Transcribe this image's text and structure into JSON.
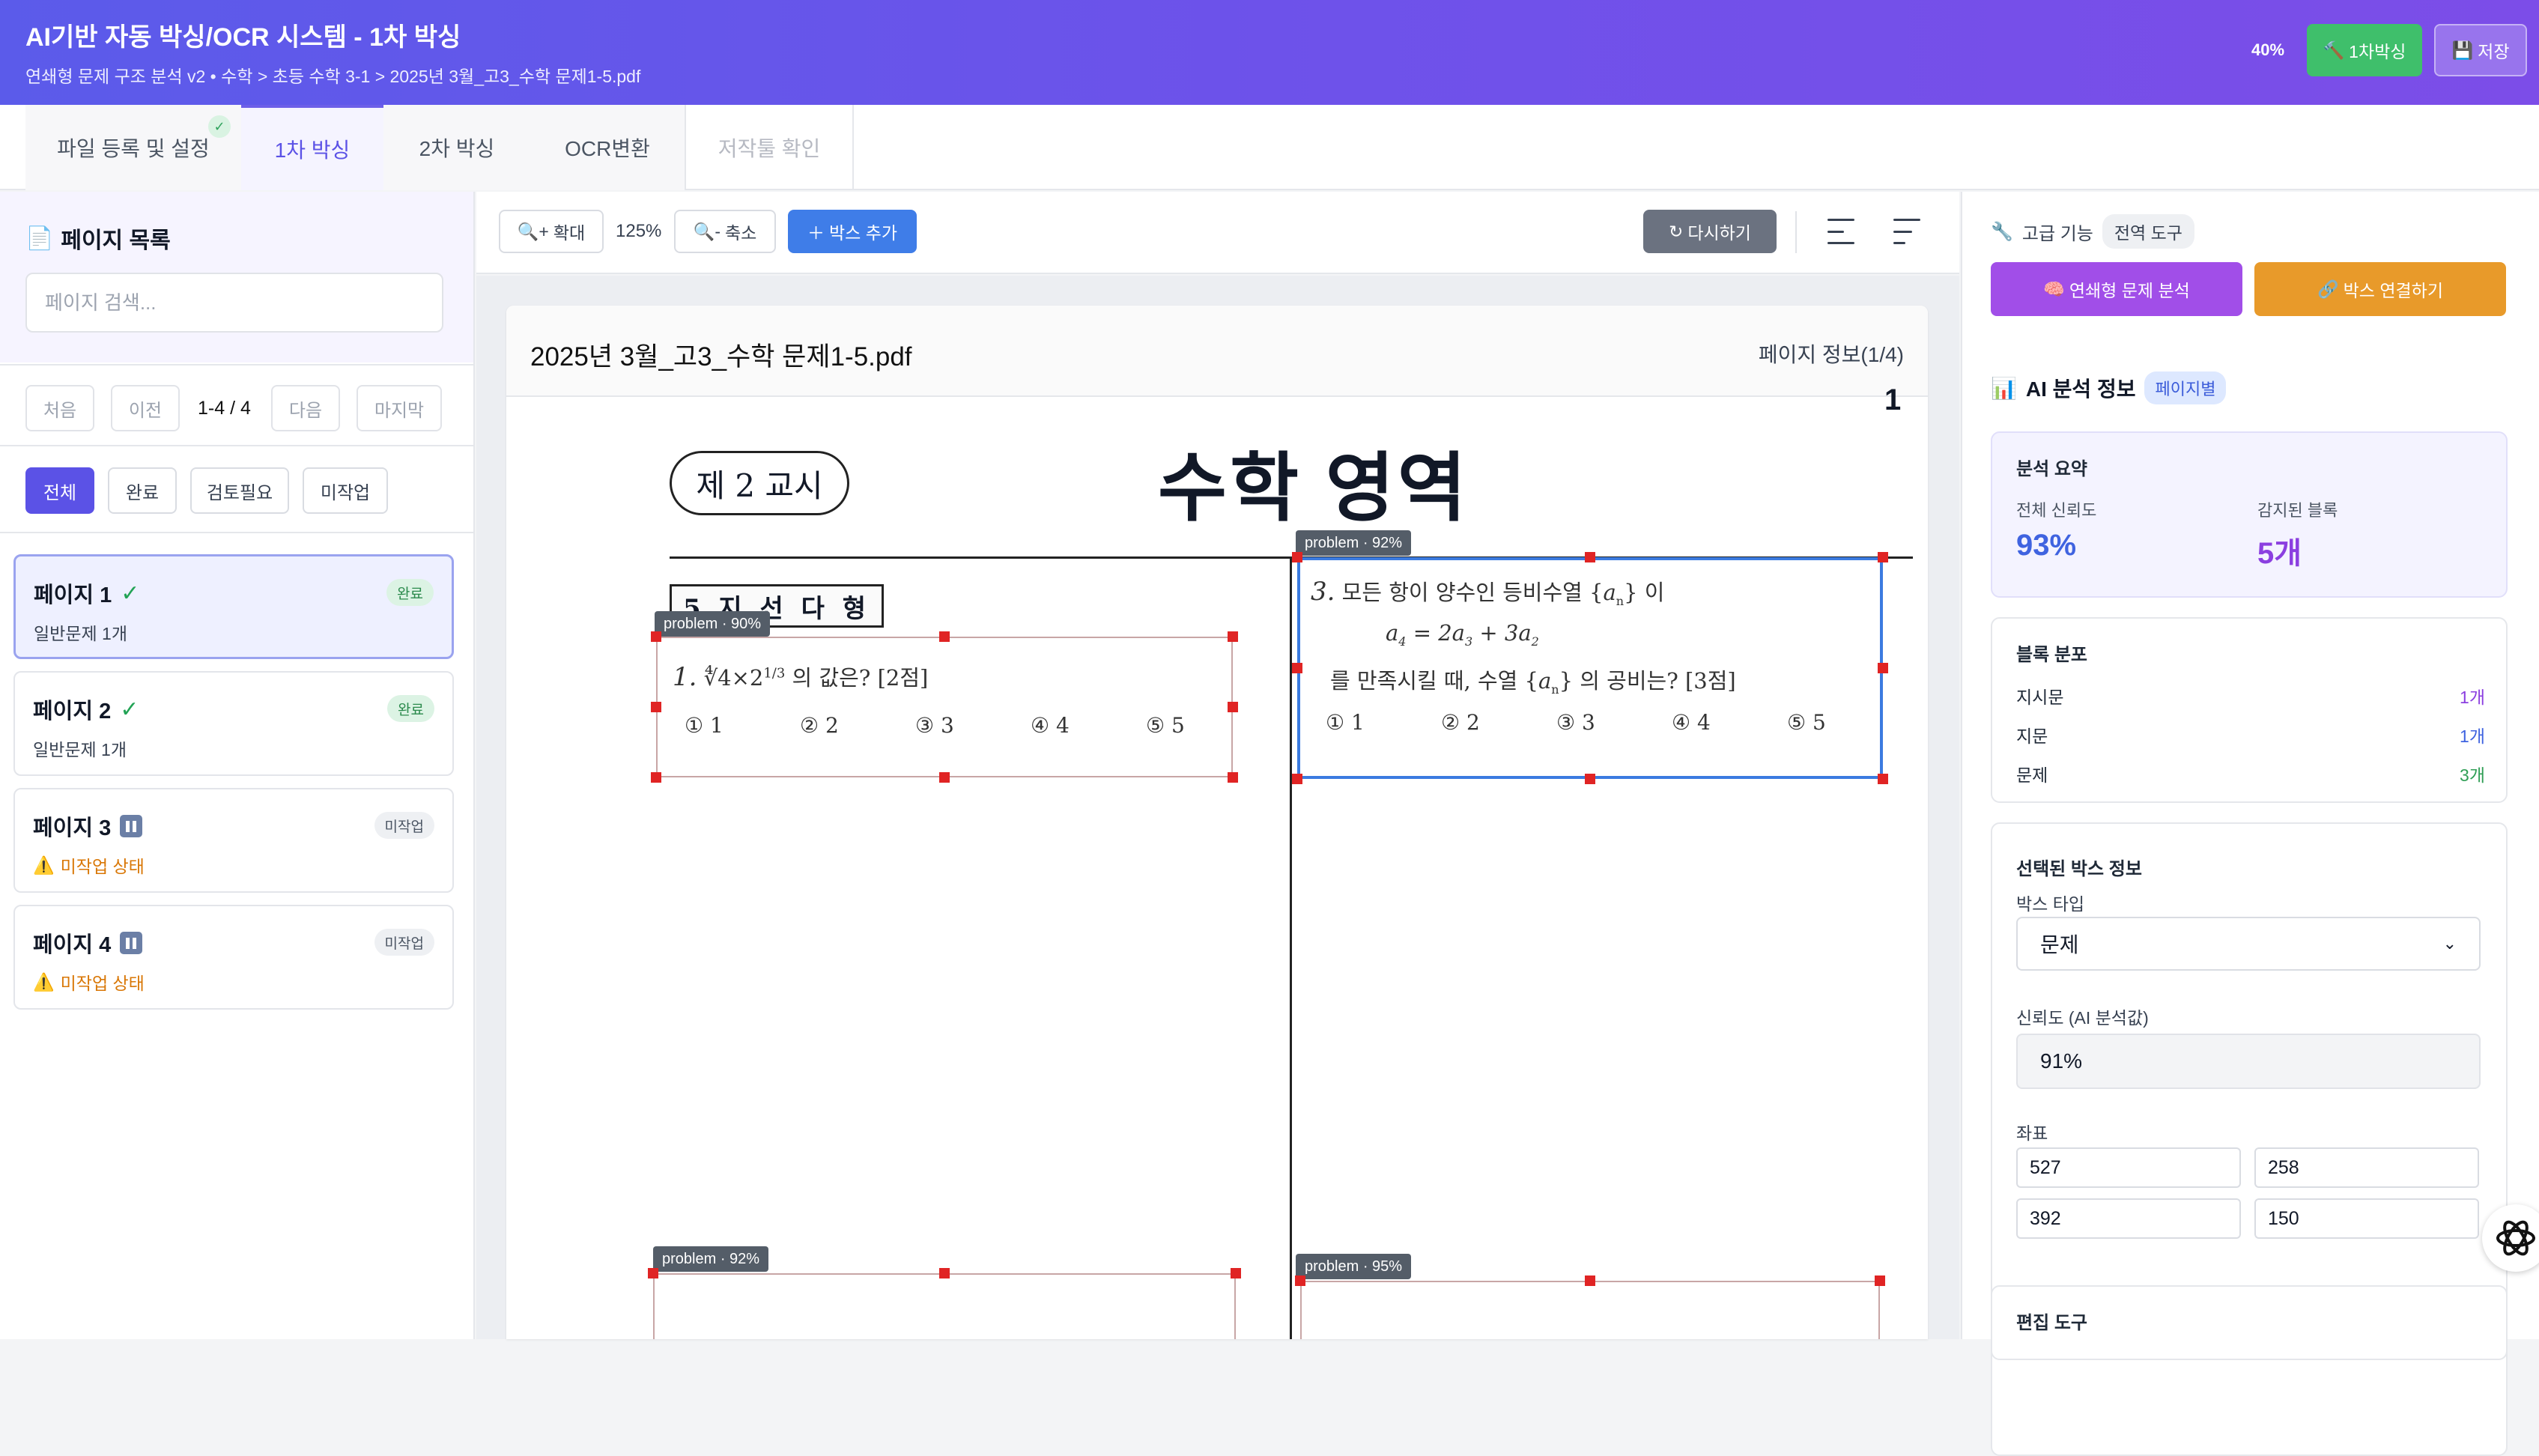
{
  "header": {
    "title": "AI기반 자동 박싱/OCR 시스템 - 1차 박싱",
    "breadcrumb": "연쇄형 문제 구조 분석 v2 • 수학 > 초등 수학 3-1 > 2025년 3월_고3_수학 문제1-5.pdf",
    "progress": "40%",
    "boxing_button": "1차박싱",
    "save_button": "저장"
  },
  "tabs": [
    "파일 등록 및 설정",
    "1차 박싱",
    "2차 박싱",
    "OCR변환",
    "저작툴 확인"
  ],
  "sidebar": {
    "title": "페이지 목록",
    "search_placeholder": "페이지 검색...",
    "pager": {
      "first": "처음",
      "prev": "이전",
      "info": "1-4 / 4",
      "next": "다음",
      "last": "마지막"
    },
    "filters": [
      "전체",
      "완료",
      "검토필요",
      "미작업"
    ],
    "pages": [
      {
        "title": "페이지 1",
        "sub": "일반문제 1개",
        "badge": "완료",
        "status": "done"
      },
      {
        "title": "페이지 2",
        "sub": "일반문제 1개",
        "badge": "완료",
        "status": "done"
      },
      {
        "title": "페이지 3",
        "sub": "미작업 상태",
        "badge": "미작업",
        "status": "todo"
      },
      {
        "title": "페이지 4",
        "sub": "미작업 상태",
        "badge": "미작업",
        "status": "todo"
      }
    ]
  },
  "toolbar": {
    "zoom_in": "확대",
    "zoom_level": "125%",
    "zoom_out": "축소",
    "add_box": "박스 추가",
    "redo": "다시하기"
  },
  "document": {
    "filename": "2025년 3월_고3_수학 문제1-5.pdf",
    "page_info": "페이지 정보(1/4)",
    "page_number": "1",
    "period": "제 2 교시",
    "subject": "수학 영역",
    "section": "5 지 선 다 형",
    "q1": {
      "num": "1.",
      "text": "의 값은? [2점]",
      "choices": [
        "① 1",
        "② 2",
        "③ 3",
        "④ 4",
        "⑤ 5"
      ]
    },
    "q3": {
      "num": "3.",
      "line1": "모든 항이 양수인 등비수열",
      "line1_end": "이",
      "line3_a": "를 만족시킬 때, 수열",
      "line3_b": "의 공비는? [3점]",
      "choices": [
        "① 1",
        "② 2",
        "③ 3",
        "④ 4",
        "⑤ 5"
      ]
    },
    "boxes": [
      {
        "label": "problem · 90%"
      },
      {
        "label": "problem · 92%"
      },
      {
        "label": "problem · 92%"
      },
      {
        "label": "problem · 95%"
      }
    ]
  },
  "panel": {
    "advanced_label": "고급 기능",
    "global_tools": "전역 도구",
    "analyze_button": "연쇄형 문제 분석",
    "link_button": "박스 연결하기",
    "ai_title": "AI 분석 정보",
    "per_page_tag": "페이지별",
    "summary": {
      "title": "분석 요약",
      "confidence_label": "전체 신뢰도",
      "confidence_value": "93%",
      "blocks_label": "감지된 블록",
      "blocks_value": "5개"
    },
    "distribution": {
      "title": "블록 분포",
      "rows": [
        {
          "name": "지시문",
          "count": "1개"
        },
        {
          "name": "지문",
          "count": "1개"
        },
        {
          "name": "문제",
          "count": "3개"
        }
      ]
    },
    "selected": {
      "title": "선택된 박스 정보",
      "type_label": "박스 타입",
      "type_value": "문제",
      "conf_label": "신뢰도 (AI 분석값)",
      "conf_value": "91%",
      "coord_label": "좌표",
      "coords": [
        "527",
        "258",
        "392",
        "150"
      ]
    },
    "edit_tools": "편집 도구"
  },
  "colors": {
    "header_start": "#5b5bea",
    "header_end": "#7c4de8",
    "accent": "#5b52e6",
    "success": "#3fbf6b",
    "selected_box": "#3b7be0",
    "handle": "#e02424"
  }
}
